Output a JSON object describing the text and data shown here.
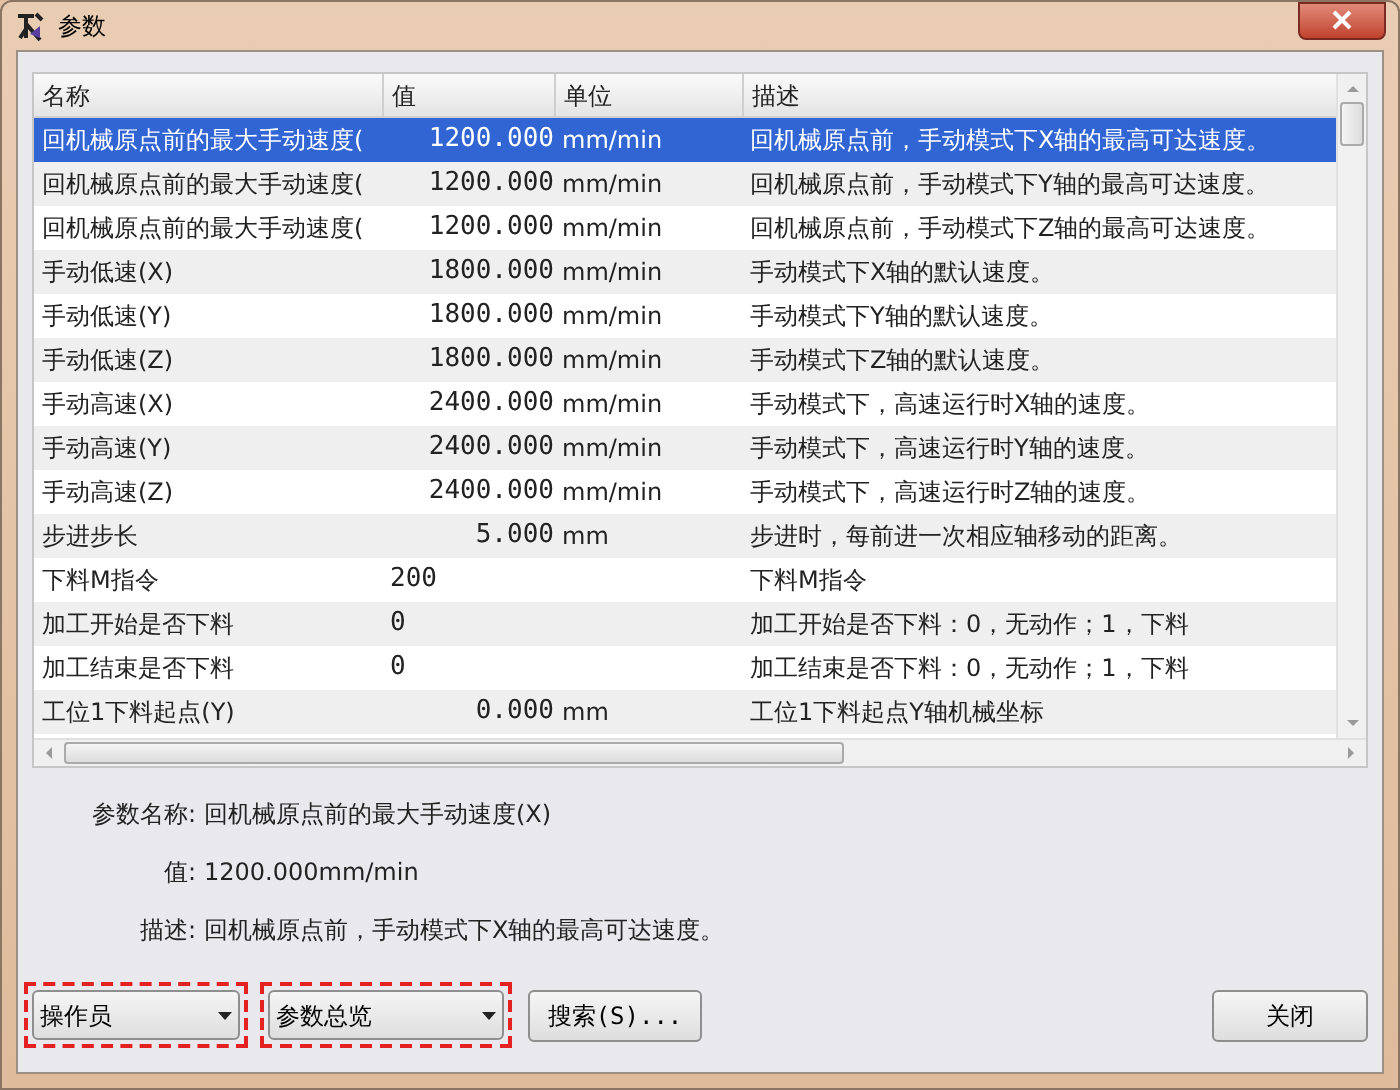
{
  "window": {
    "title": "参数"
  },
  "table": {
    "columns": [
      "名称",
      "值",
      "单位",
      "描述"
    ],
    "rows": [
      {
        "name": "回机械原点前的最大手动速度(",
        "value": "1200.000",
        "kind": "decimal",
        "unit": "mm/min",
        "description": "回机械原点前，手动模式下X轴的最高可达速度。",
        "selected": true
      },
      {
        "name": "回机械原点前的最大手动速度(",
        "value": "1200.000",
        "kind": "decimal",
        "unit": "mm/min",
        "description": "回机械原点前，手动模式下Y轴的最高可达速度。",
        "selected": false
      },
      {
        "name": "回机械原点前的最大手动速度(",
        "value": "1200.000",
        "kind": "decimal",
        "unit": "mm/min",
        "description": "回机械原点前，手动模式下Z轴的最高可达速度。",
        "selected": false
      },
      {
        "name": "手动低速(X)",
        "value": "1800.000",
        "kind": "decimal",
        "unit": "mm/min",
        "description": "手动模式下X轴的默认速度。",
        "selected": false
      },
      {
        "name": "手动低速(Y)",
        "value": "1800.000",
        "kind": "decimal",
        "unit": "mm/min",
        "description": "手动模式下Y轴的默认速度。",
        "selected": false
      },
      {
        "name": "手动低速(Z)",
        "value": "1800.000",
        "kind": "decimal",
        "unit": "mm/min",
        "description": "手动模式下Z轴的默认速度。",
        "selected": false
      },
      {
        "name": "手动高速(X)",
        "value": "2400.000",
        "kind": "decimal",
        "unit": "mm/min",
        "description": "手动模式下，高速运行时X轴的速度。",
        "selected": false
      },
      {
        "name": "手动高速(Y)",
        "value": "2400.000",
        "kind": "decimal",
        "unit": "mm/min",
        "description": "手动模式下，高速运行时Y轴的速度。",
        "selected": false
      },
      {
        "name": "手动高速(Z)",
        "value": "2400.000",
        "kind": "decimal",
        "unit": "mm/min",
        "description": "手动模式下，高速运行时Z轴的速度。",
        "selected": false
      },
      {
        "name": "步进步长",
        "value": "5.000",
        "kind": "decimal",
        "unit": "mm",
        "description": "步进时，每前进一次相应轴移动的距离。",
        "selected": false
      },
      {
        "name": "下料M指令",
        "value": "200",
        "kind": "integer",
        "description": "下料M指令",
        "selected": false
      },
      {
        "name": "加工开始是否下料",
        "value": "0",
        "kind": "integer",
        "description": "加工开始是否下料：0，无动作；1，下料",
        "selected": false
      },
      {
        "name": "加工结束是否下料",
        "value": "0",
        "kind": "integer",
        "description": "加工结束是否下料：0，无动作；1，下料",
        "selected": false
      },
      {
        "name": "工位1下料起点(Y)",
        "value": "0.000",
        "kind": "decimal",
        "unit": "mm",
        "description": "工位1下料起点Y轴机械坐标",
        "selected": false
      }
    ]
  },
  "details": [
    {
      "label": "参数名称:",
      "value": "回机械原点前的最大手动速度(X)"
    },
    {
      "label": "值:",
      "value": "1200.000mm/min"
    },
    {
      "label": "描述:",
      "value": "回机械原点前，手动模式下X轴的最高可达速度。"
    }
  ],
  "dropdowns": [
    {
      "value": "操作员",
      "highlighted": true
    },
    {
      "value": "参数总览",
      "highlighted": true
    }
  ],
  "search_button": "搜索(S)...",
  "close_button": "关闭"
}
